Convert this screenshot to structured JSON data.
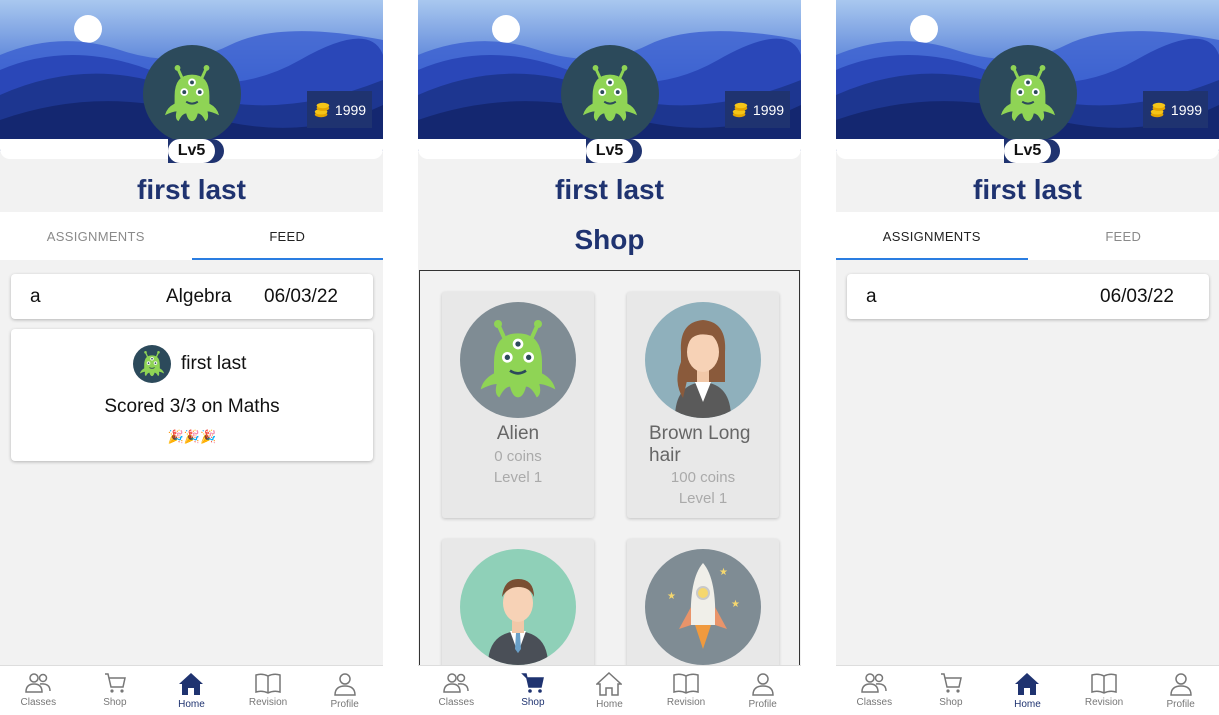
{
  "colors": {
    "primary": "#1f3370",
    "accent": "#2a7de1",
    "alien_green": "#8fd455",
    "avatar_bg": "#2c4a5b"
  },
  "profile": {
    "name": "first last",
    "level": "Lv5",
    "coins": "1999",
    "avatar_icon": "alien-icon"
  },
  "nav": {
    "classes": "Classes",
    "shop": "Shop",
    "home": "Home",
    "revision": "Revision",
    "profile": "Profile"
  },
  "screen1": {
    "tabs": {
      "assignments": "ASSIGNMENTS",
      "feed": "FEED"
    },
    "active_tab": "feed",
    "assignment": {
      "name": "a",
      "subject": "Algebra",
      "date": "06/03/22"
    },
    "feed_post": {
      "user": "first last",
      "message": "Scored 3/3 on Maths",
      "emoji": "🎉🎉🎉"
    }
  },
  "screen2": {
    "title": "Shop",
    "items": [
      {
        "name": "Alien",
        "price": "0 coins",
        "level": "Level 1",
        "icon": "alien-icon"
      },
      {
        "name": "Brown Long hair",
        "price": "100 coins",
        "level": "Level 1",
        "icon": "woman-icon"
      },
      {
        "name": "",
        "price": "",
        "level": "",
        "icon": "businessman-icon"
      },
      {
        "name": "",
        "price": "",
        "level": "",
        "icon": "rocket-icon"
      }
    ]
  },
  "screen3": {
    "tabs": {
      "assignments": "ASSIGNMENTS",
      "feed": "FEED"
    },
    "active_tab": "assignments",
    "assignment": {
      "name": "a",
      "date": "06/03/22"
    }
  }
}
